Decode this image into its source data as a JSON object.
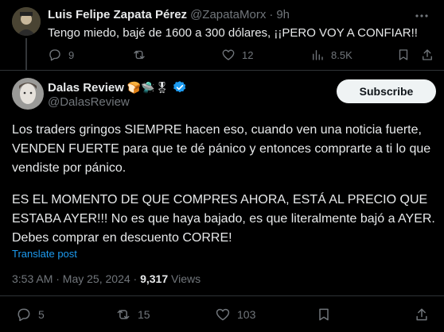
{
  "reply": {
    "author_name": "Luis Felipe Zapata Pérez",
    "author_handle": "@ZapataMorx",
    "separator": "·",
    "time_ago": "9h",
    "text": "Tengo miedo, bajé de 1600 a 300 dólares, ¡¡PERO VOY A CONFIAR!!",
    "replies": "9",
    "likes": "12",
    "views": "8.5K",
    "more_icon": "more-dots-icon"
  },
  "post": {
    "author_name": "Dalas Review",
    "author_badges": "🍞🛸🎖",
    "author_handle": "@DalasReview",
    "subscribe_label": "Subscribe",
    "paragraph_1": "Los traders gringos SIEMPRE hacen eso, cuando ven una noticia fuerte, VENDEN FUERTE para que te dé pánico y entonces comprarte a ti lo que vendiste por pánico.",
    "paragraph_2": "ES EL MOMENTO DE QUE COMPRES AHORA, ESTÁ AL PRECIO QUE ESTABA AYER!!! No es que haya bajado, es que literalmente bajó a AYER. Debes comprar en descuento CORRE!",
    "translate_label": "Translate post",
    "timestamp": "3:53 AM · May 25, 2024 · ",
    "view_count": "9,317",
    "views_label": " Views",
    "replies": "5",
    "reposts": "15",
    "likes": "103"
  },
  "colors": {
    "background": "#000000",
    "text": "#e7e9ea",
    "muted": "#71767b",
    "link": "#1d9bf0",
    "verified": "#1d9bf0"
  }
}
